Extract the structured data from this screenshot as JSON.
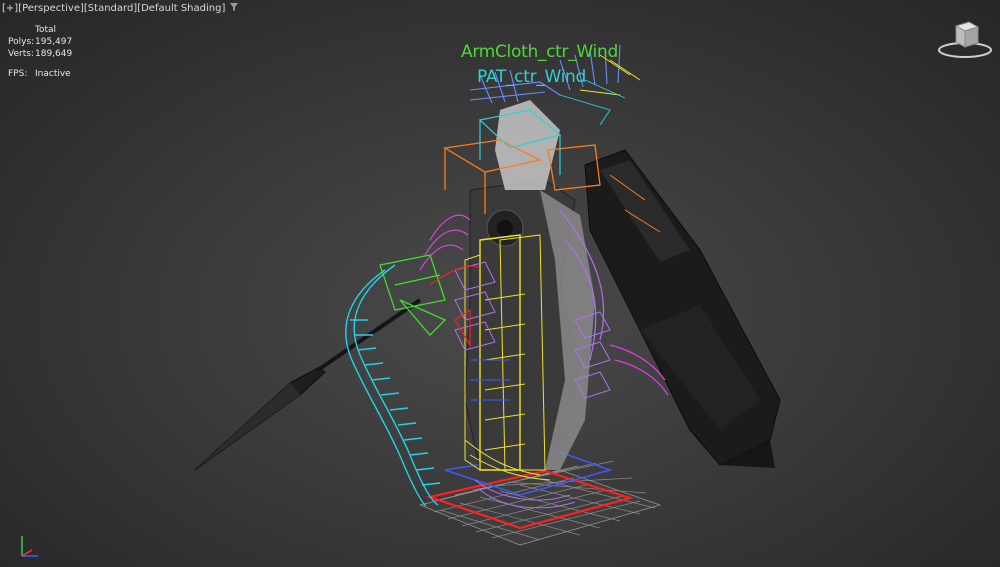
{
  "viewport": {
    "labels": [
      "[+]",
      "[Perspective]",
      "[Standard]",
      "[Default Shading]"
    ],
    "filter_icon": "filter-funnel-icon"
  },
  "stats": {
    "header": "Total",
    "polys_label": "Polys:",
    "polys_value": "195,497",
    "verts_label": "Verts:",
    "verts_value": "189,649",
    "fps_label": "FPS:",
    "fps_value": "Inactive"
  },
  "scene": {
    "label_arm": "ArmCloth_ctr_Wind",
    "label_pat": "PAT_ctr_Wind",
    "colors": {
      "arm_label": "#4fd83a",
      "pat_label": "#2fd0d0",
      "cyan": "#22d3e6",
      "green": "#3fdc2f",
      "orange": "#ff7a1a",
      "yellow": "#f0e22a",
      "purple": "#b070f0",
      "magenta": "#e040e0",
      "red": "#ff2020",
      "blue": "#3a5cff"
    }
  },
  "viewcube": {
    "icon": "viewcube-icon"
  },
  "axis": {
    "icon": "axis-tripod-icon"
  }
}
